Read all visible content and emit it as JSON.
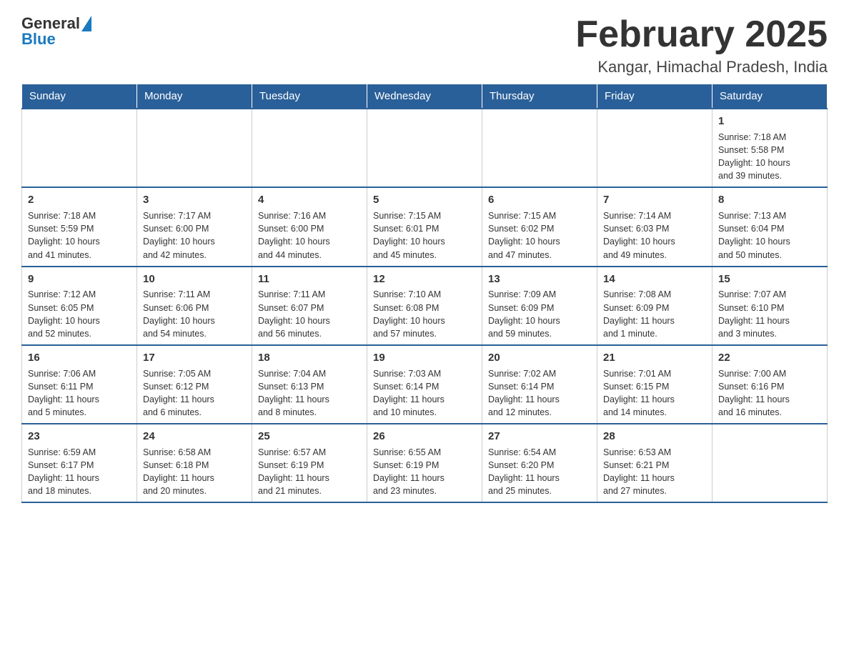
{
  "logo": {
    "general": "General",
    "blue": "Blue"
  },
  "header": {
    "title": "February 2025",
    "location": "Kangar, Himachal Pradesh, India"
  },
  "days_of_week": [
    "Sunday",
    "Monday",
    "Tuesday",
    "Wednesday",
    "Thursday",
    "Friday",
    "Saturday"
  ],
  "weeks": [
    {
      "days": [
        {
          "num": "",
          "info": ""
        },
        {
          "num": "",
          "info": ""
        },
        {
          "num": "",
          "info": ""
        },
        {
          "num": "",
          "info": ""
        },
        {
          "num": "",
          "info": ""
        },
        {
          "num": "",
          "info": ""
        },
        {
          "num": "1",
          "info": "Sunrise: 7:18 AM\nSunset: 5:58 PM\nDaylight: 10 hours\nand 39 minutes."
        }
      ]
    },
    {
      "days": [
        {
          "num": "2",
          "info": "Sunrise: 7:18 AM\nSunset: 5:59 PM\nDaylight: 10 hours\nand 41 minutes."
        },
        {
          "num": "3",
          "info": "Sunrise: 7:17 AM\nSunset: 6:00 PM\nDaylight: 10 hours\nand 42 minutes."
        },
        {
          "num": "4",
          "info": "Sunrise: 7:16 AM\nSunset: 6:00 PM\nDaylight: 10 hours\nand 44 minutes."
        },
        {
          "num": "5",
          "info": "Sunrise: 7:15 AM\nSunset: 6:01 PM\nDaylight: 10 hours\nand 45 minutes."
        },
        {
          "num": "6",
          "info": "Sunrise: 7:15 AM\nSunset: 6:02 PM\nDaylight: 10 hours\nand 47 minutes."
        },
        {
          "num": "7",
          "info": "Sunrise: 7:14 AM\nSunset: 6:03 PM\nDaylight: 10 hours\nand 49 minutes."
        },
        {
          "num": "8",
          "info": "Sunrise: 7:13 AM\nSunset: 6:04 PM\nDaylight: 10 hours\nand 50 minutes."
        }
      ]
    },
    {
      "days": [
        {
          "num": "9",
          "info": "Sunrise: 7:12 AM\nSunset: 6:05 PM\nDaylight: 10 hours\nand 52 minutes."
        },
        {
          "num": "10",
          "info": "Sunrise: 7:11 AM\nSunset: 6:06 PM\nDaylight: 10 hours\nand 54 minutes."
        },
        {
          "num": "11",
          "info": "Sunrise: 7:11 AM\nSunset: 6:07 PM\nDaylight: 10 hours\nand 56 minutes."
        },
        {
          "num": "12",
          "info": "Sunrise: 7:10 AM\nSunset: 6:08 PM\nDaylight: 10 hours\nand 57 minutes."
        },
        {
          "num": "13",
          "info": "Sunrise: 7:09 AM\nSunset: 6:09 PM\nDaylight: 10 hours\nand 59 minutes."
        },
        {
          "num": "14",
          "info": "Sunrise: 7:08 AM\nSunset: 6:09 PM\nDaylight: 11 hours\nand 1 minute."
        },
        {
          "num": "15",
          "info": "Sunrise: 7:07 AM\nSunset: 6:10 PM\nDaylight: 11 hours\nand 3 minutes."
        }
      ]
    },
    {
      "days": [
        {
          "num": "16",
          "info": "Sunrise: 7:06 AM\nSunset: 6:11 PM\nDaylight: 11 hours\nand 5 minutes."
        },
        {
          "num": "17",
          "info": "Sunrise: 7:05 AM\nSunset: 6:12 PM\nDaylight: 11 hours\nand 6 minutes."
        },
        {
          "num": "18",
          "info": "Sunrise: 7:04 AM\nSunset: 6:13 PM\nDaylight: 11 hours\nand 8 minutes."
        },
        {
          "num": "19",
          "info": "Sunrise: 7:03 AM\nSunset: 6:14 PM\nDaylight: 11 hours\nand 10 minutes."
        },
        {
          "num": "20",
          "info": "Sunrise: 7:02 AM\nSunset: 6:14 PM\nDaylight: 11 hours\nand 12 minutes."
        },
        {
          "num": "21",
          "info": "Sunrise: 7:01 AM\nSunset: 6:15 PM\nDaylight: 11 hours\nand 14 minutes."
        },
        {
          "num": "22",
          "info": "Sunrise: 7:00 AM\nSunset: 6:16 PM\nDaylight: 11 hours\nand 16 minutes."
        }
      ]
    },
    {
      "days": [
        {
          "num": "23",
          "info": "Sunrise: 6:59 AM\nSunset: 6:17 PM\nDaylight: 11 hours\nand 18 minutes."
        },
        {
          "num": "24",
          "info": "Sunrise: 6:58 AM\nSunset: 6:18 PM\nDaylight: 11 hours\nand 20 minutes."
        },
        {
          "num": "25",
          "info": "Sunrise: 6:57 AM\nSunset: 6:19 PM\nDaylight: 11 hours\nand 21 minutes."
        },
        {
          "num": "26",
          "info": "Sunrise: 6:55 AM\nSunset: 6:19 PM\nDaylight: 11 hours\nand 23 minutes."
        },
        {
          "num": "27",
          "info": "Sunrise: 6:54 AM\nSunset: 6:20 PM\nDaylight: 11 hours\nand 25 minutes."
        },
        {
          "num": "28",
          "info": "Sunrise: 6:53 AM\nSunset: 6:21 PM\nDaylight: 11 hours\nand 27 minutes."
        },
        {
          "num": "",
          "info": ""
        }
      ]
    }
  ]
}
